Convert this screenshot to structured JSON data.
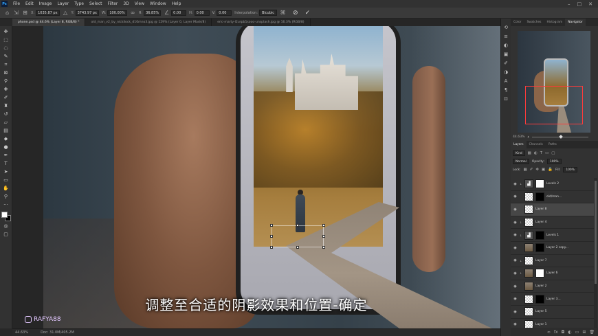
{
  "menu": [
    "File",
    "Edit",
    "Image",
    "Layer",
    "Type",
    "Select",
    "Filter",
    "3D",
    "View",
    "Window",
    "Help"
  ],
  "options": {
    "x_label": "X:",
    "x_value": "1035.87 px",
    "y_label": "Y:",
    "y_value": "3743.97 px",
    "w_label": "W:",
    "w_value": "100.00%",
    "h_label": "H:",
    "h_value": "36.85%",
    "angle_value": "0.00",
    "hskew_label": "H:",
    "hskew_value": "0.00",
    "vskew_label": "V:",
    "vskew_value": "0.00",
    "interp_label": "Interpolation:",
    "interp_value": "Bicubic"
  },
  "tabs": [
    "phone.psd @ 44.6% (Layer 8, RGB/8) *",
    "old_man_v2_by_nickilock_d10mno3.jpg @ 129% (Layer 0, Layer Mask/8)",
    "eric-marty-l2urpb1sooo-unsplash.jpg @ 16.3% (RGB/8)"
  ],
  "subtitle": "调整至合适的阴影效果和位置-确定",
  "watermark": "RAFYA88",
  "status": {
    "zoom": "44.63%",
    "doc": "Doc: 31.0M/405.2M"
  },
  "panel_tabs": [
    "Color",
    "Swatches",
    "Histogram",
    "Navigator"
  ],
  "navigator_zoom": "44.63%",
  "layer_tabs": [
    "Layers",
    "Channels",
    "Paths"
  ],
  "layer_controls": {
    "kind": "Kind",
    "blend": "Normal",
    "opacity_label": "Opacity:",
    "opacity_value": "100%",
    "lock_label": "Lock:",
    "fill_label": "Fill:",
    "fill_value": "100%"
  },
  "layers": [
    {
      "name": "Levels 2"
    },
    {
      "name": "old/man..."
    },
    {
      "name": "Layer 8"
    },
    {
      "name": "Layer 4"
    },
    {
      "name": "Levels 1"
    },
    {
      "name": "Layer 2 copy..."
    },
    {
      "name": "Layer 7"
    },
    {
      "name": "Layer 6"
    },
    {
      "name": "Layer 2"
    },
    {
      "name": "Layer 3..."
    },
    {
      "name": "Layer 5"
    },
    {
      "name": "Layer 1"
    }
  ],
  "colors": {
    "accent": "#31a8ff",
    "selected_layer": "#474747",
    "navigator_view": "#ff3b3b"
  }
}
